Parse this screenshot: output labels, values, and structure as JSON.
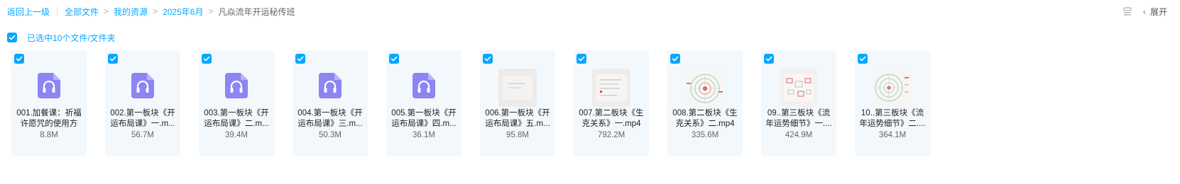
{
  "breadcrumb": {
    "back": "返回上一级",
    "items": [
      "全部文件",
      "我的资源",
      "2025年6月"
    ],
    "current": "凡焱流年开运秘传班"
  },
  "toolbar": {
    "expand_label": "展开"
  },
  "selection": {
    "text": "已选中10个文件/文件夹",
    "checked": true
  },
  "colors": {
    "accent": "#06a7ff",
    "card_bg": "#f3f8fd",
    "audio_icon": "#8d85f3"
  },
  "files": [
    {
      "name": "001.加餐课：祈福许愿咒的使用方",
      "size": "8.8M",
      "type": "audio",
      "checked": true
    },
    {
      "name": "002.第一板块《开运布局课》一.m...",
      "size": "56.7M",
      "type": "audio",
      "checked": true
    },
    {
      "name": "003.第一板块《开运布局课》二.m...",
      "size": "39.4M",
      "type": "audio",
      "checked": true
    },
    {
      "name": "004.第一板块《开运布局课》三.m...",
      "size": "50.3M",
      "type": "audio",
      "checked": true
    },
    {
      "name": "005.第一板块《开运布局课》四.m...",
      "size": "36.1M",
      "type": "audio",
      "checked": true
    },
    {
      "name": "006.第一板块《开运布局课》五.m...",
      "size": "95.8M",
      "type": "video",
      "checked": true
    },
    {
      "name": "007.第二板块《生克关系》一.mp4",
      "size": "792.2M",
      "type": "video",
      "checked": true
    },
    {
      "name": "008.第二板块《生克关系》二.mp4",
      "size": "335.6M",
      "type": "video",
      "checked": true
    },
    {
      "name": "09..第三板块《流年运势细节》一....",
      "size": "424.9M",
      "type": "video",
      "checked": true
    },
    {
      "name": "10..第三板块《流年运势细节》二....",
      "size": "364.1M",
      "type": "video",
      "checked": true
    }
  ]
}
